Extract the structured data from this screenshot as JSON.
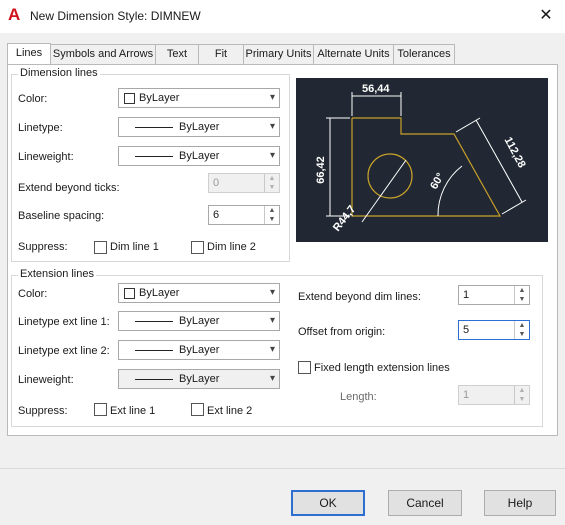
{
  "window": {
    "title": "New Dimension Style: DIMNEW",
    "app_icon": "autocad-a-icon",
    "close": "✕"
  },
  "tabs": [
    "Lines",
    "Symbols and Arrows",
    "Text",
    "Fit",
    "Primary Units",
    "Alternate Units",
    "Tolerances"
  ],
  "dimension_lines": {
    "title": "Dimension lines",
    "color_label": "Color:",
    "color_value": "ByLayer",
    "linetype_label": "Linetype:",
    "linetype_value": "ByLayer",
    "lineweight_label": "Lineweight:",
    "lineweight_value": "ByLayer",
    "extend_label": "Extend beyond ticks:",
    "extend_value": "0",
    "baseline_label": "Baseline spacing:",
    "baseline_value": "6",
    "suppress_label": "Suppress:",
    "dim_line1": "Dim line 1",
    "dim_line2": "Dim line 2"
  },
  "extension_lines": {
    "title": "Extension lines",
    "color_label": "Color:",
    "color_value": "ByLayer",
    "lt1_label": "Linetype ext line 1:",
    "lt1_value": "ByLayer",
    "lt2_label": "Linetype ext line 2:",
    "lt2_value": "ByLayer",
    "lineweight_label": "Lineweight:",
    "lineweight_value": "ByLayer",
    "suppress_label": "Suppress:",
    "ext_line1": "Ext line 1",
    "ext_line2": "Ext line 2",
    "extend_dim_label": "Extend beyond dim lines:",
    "extend_dim_value": "1",
    "offset_label": "Offset from origin:",
    "offset_value": "5",
    "fixed_label": "Fixed length extension lines",
    "length_label": "Length:",
    "length_value": "1"
  },
  "preview": {
    "dim_top": "56,44",
    "dim_left": "66,42",
    "dim_diag": "112,28",
    "dim_angle": "60°",
    "dim_radius": "R44,7"
  },
  "buttons": {
    "ok": "OK",
    "cancel": "Cancel",
    "help": "Help"
  },
  "colors": {
    "preview_bg": "#212833",
    "shape": "#c8a12a",
    "dim": "#ffffff",
    "accent": "#2d6fd0"
  }
}
